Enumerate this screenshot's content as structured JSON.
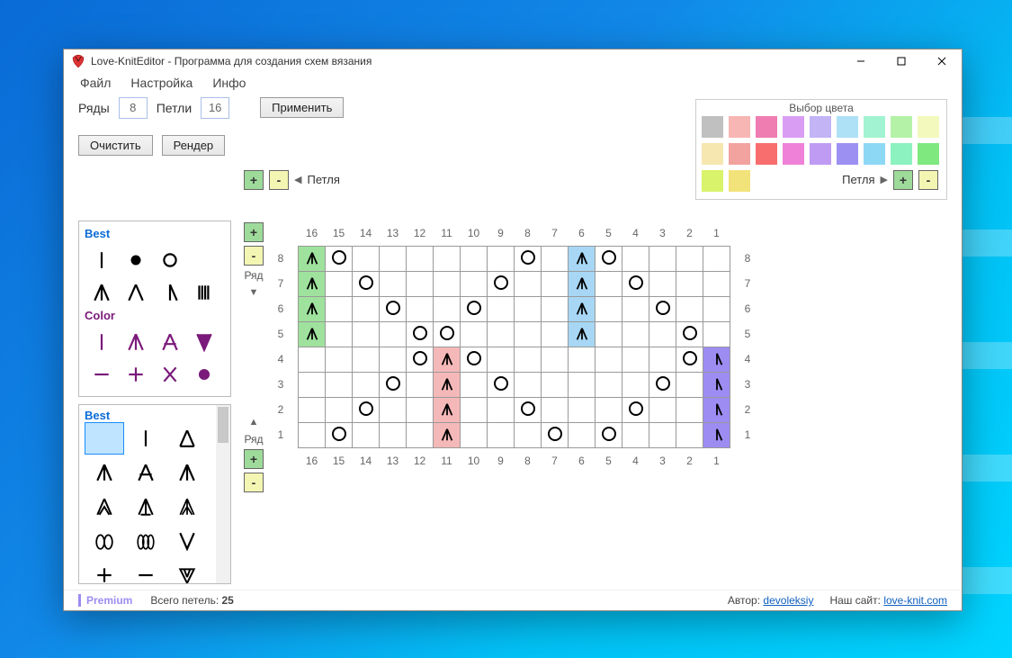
{
  "title": "Love-KnitEditor - Программа для создания схем вязания",
  "menu": {
    "file": "Файл",
    "settings": "Настройка",
    "info": "Инфо"
  },
  "labels": {
    "rows": "Ряды",
    "loops": "Петли",
    "apply": "Применить",
    "clear": "Очистить",
    "render": "Рендер",
    "loop": "Петля",
    "row": "Ряд",
    "colorpick": "Выбор цвета"
  },
  "values": {
    "rows": "8",
    "loops": "16"
  },
  "palettes": {
    "best": "Best",
    "color": "Color",
    "best2": "Best"
  },
  "colors": [
    "#c0c0c0",
    "#f7b6b3",
    "#ef7db2",
    "#d99ef3",
    "#c2b4f5",
    "#aee1f5",
    "#a2f3d1",
    "#b4f2a7",
    "#f3f9bc",
    "#f6e6b0",
    "#f2a29f",
    "#f86e6e",
    "#ef82d8",
    "#bf9bf3",
    "#9c90f3",
    "#8dd8f5",
    "#8cf2c0",
    "#7fe87f",
    "#d9f36a",
    "#f2e27a"
  ],
  "chart_data": {
    "type": "grid",
    "cols": 16,
    "rows": 8,
    "col_labels_top": [
      "16",
      "15",
      "14",
      "13",
      "12",
      "11",
      "10",
      "9",
      "8",
      "7",
      "6",
      "5",
      "4",
      "3",
      "2",
      "1"
    ],
    "col_labels_bot": [
      "16",
      "15",
      "14",
      "13",
      "12",
      "11",
      "10",
      "9",
      "8",
      "7",
      "6",
      "5",
      "4",
      "3",
      "2",
      "1"
    ],
    "row_labels_left": [
      "8",
      "7",
      "6",
      "5",
      "4",
      "3",
      "2",
      "1"
    ],
    "row_labels_right": [
      "8",
      "7",
      "6",
      "5",
      "4",
      "3",
      "2",
      "1"
    ],
    "cells": [
      [
        {
          "s": "A",
          "c": "g"
        },
        {
          "s": "o"
        },
        {},
        {},
        {},
        {},
        {},
        {},
        {
          "s": "o"
        },
        {},
        {
          "s": "A",
          "c": "b"
        },
        {
          "s": "o"
        },
        {},
        {},
        {},
        {}
      ],
      [
        {
          "s": "A",
          "c": "g"
        },
        {},
        {
          "s": "o"
        },
        {},
        {},
        {},
        {},
        {
          "s": "o"
        },
        {},
        {},
        {
          "s": "A",
          "c": "b"
        },
        {},
        {
          "s": "o"
        },
        {},
        {},
        {}
      ],
      [
        {
          "s": "A",
          "c": "g"
        },
        {},
        {},
        {
          "s": "o"
        },
        {},
        {},
        {
          "s": "o"
        },
        {},
        {},
        {},
        {
          "s": "A",
          "c": "b"
        },
        {},
        {},
        {
          "s": "o"
        },
        {},
        {}
      ],
      [
        {
          "s": "A",
          "c": "g"
        },
        {},
        {},
        {},
        {
          "s": "o"
        },
        {
          "s": "o"
        },
        {},
        {},
        {},
        {},
        {
          "s": "A",
          "c": "b"
        },
        {},
        {},
        {},
        {
          "s": "o"
        },
        {}
      ],
      [
        {},
        {},
        {},
        {},
        {
          "s": "o"
        },
        {
          "s": "A",
          "c": "p"
        },
        {
          "s": "o"
        },
        {},
        {},
        {},
        {},
        {},
        {},
        {},
        {
          "s": "o"
        },
        {
          "s": "L",
          "c": "v"
        }
      ],
      [
        {},
        {},
        {},
        {
          "s": "o"
        },
        {},
        {
          "s": "A",
          "c": "p"
        },
        {},
        {
          "s": "o"
        },
        {},
        {},
        {},
        {},
        {},
        {
          "s": "o"
        },
        {},
        {
          "s": "L",
          "c": "v"
        }
      ],
      [
        {},
        {},
        {
          "s": "o"
        },
        {},
        {},
        {
          "s": "A",
          "c": "p"
        },
        {},
        {},
        {
          "s": "o"
        },
        {},
        {},
        {},
        {
          "s": "o"
        },
        {},
        {},
        {
          "s": "L",
          "c": "v"
        }
      ],
      [
        {},
        {
          "s": "o"
        },
        {},
        {},
        {},
        {
          "s": "A",
          "c": "p"
        },
        {},
        {},
        {},
        {
          "s": "o"
        },
        {},
        {
          "s": "o"
        },
        {},
        {},
        {},
        {
          "s": "L",
          "c": "v"
        }
      ]
    ]
  },
  "footer": {
    "premium": "Premium",
    "total_label": "Всего петель:",
    "total": "25",
    "author_label": "Автор:",
    "author": "devoleksiy",
    "site_label": "Наш сайт:",
    "site": "love-knit.com"
  }
}
